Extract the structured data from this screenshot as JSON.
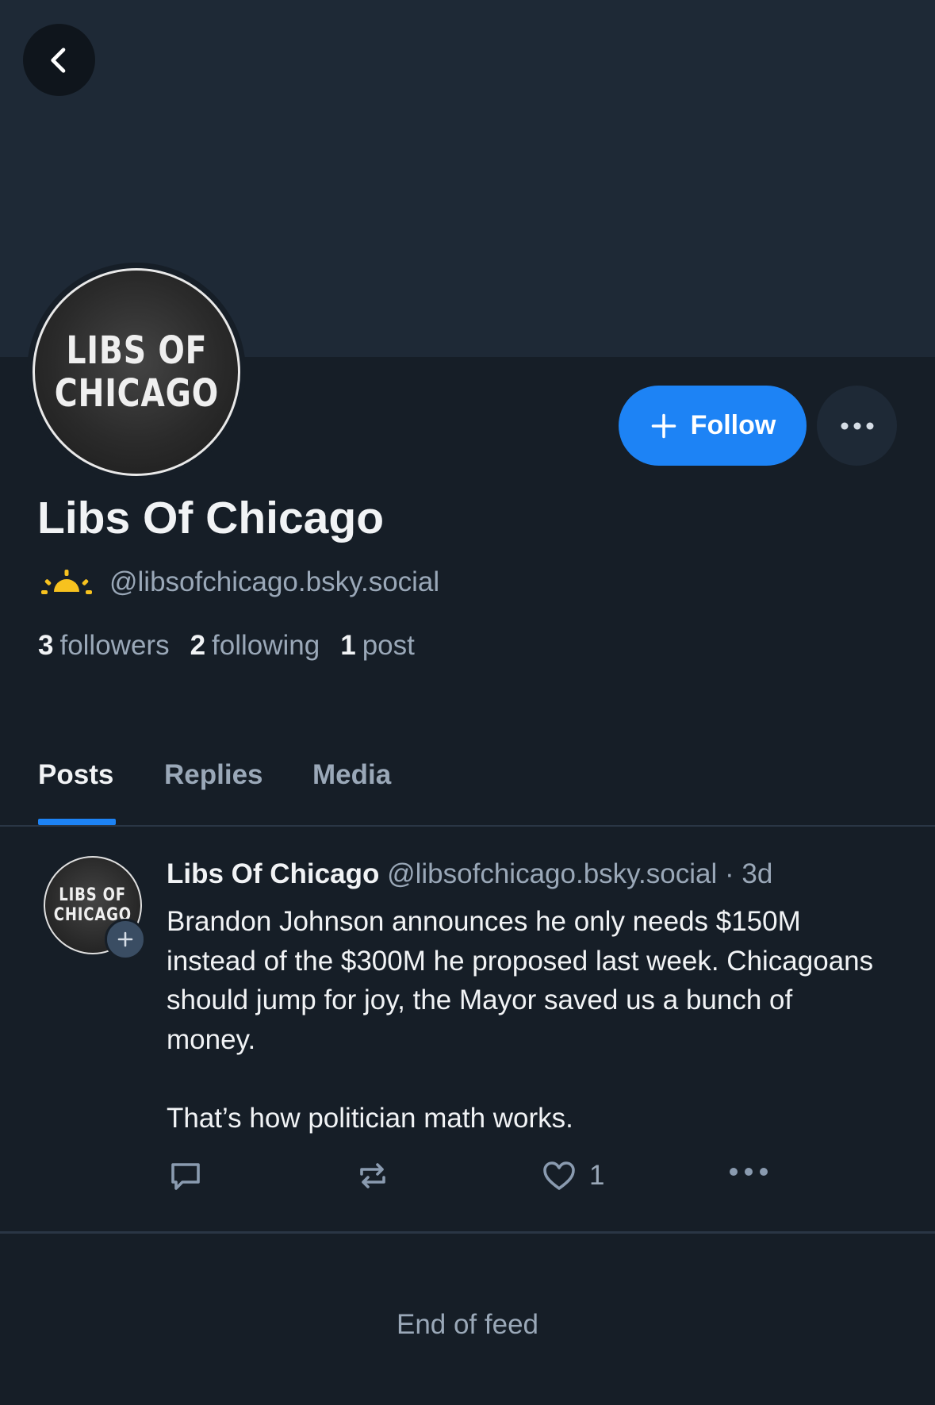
{
  "navigation": {
    "back_icon": "chevron-left-icon"
  },
  "profile": {
    "avatar_logo_lines": [
      "LIBS OF",
      "CHICAGO"
    ],
    "display_name": "Libs Of Chicago",
    "handle": "@libsofchicago.bsky.social",
    "handle_icon": "sunrise-icon",
    "stats": {
      "followers_count": "3",
      "followers_label": "followers",
      "following_count": "2",
      "following_label": "following",
      "posts_count": "1",
      "posts_label": "post"
    }
  },
  "actions": {
    "follow_label": "Follow",
    "more_icon": "more-horizontal-icon"
  },
  "tabs": [
    {
      "label": "Posts",
      "active": true
    },
    {
      "label": "Replies",
      "active": false
    },
    {
      "label": "Media",
      "active": false
    }
  ],
  "post": {
    "author": "Libs Of Chicago",
    "handle": "@libsofchicago.bsky.social",
    "separator": "·",
    "time": "3d",
    "text_paragraph_1": "Brandon Johnson announces he only needs $150M instead of the $300M he proposed last week. Chicagoans should jump for joy, the Mayor saved us a bunch of money.",
    "text_paragraph_2": "That’s how politician math works.",
    "like_count": "1"
  },
  "feed": {
    "end_label": "End of feed"
  },
  "colors": {
    "background": "#161e27",
    "banner": "#1e2936",
    "accent": "#1d83f5",
    "muted_text": "#9aa8b8",
    "sun_icon": "#f7c21f"
  }
}
